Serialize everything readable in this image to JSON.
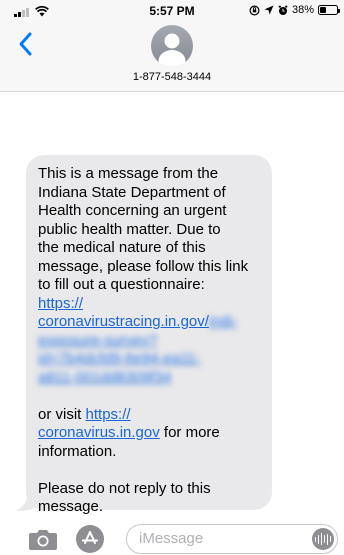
{
  "status_bar": {
    "time": "5:57 PM",
    "battery_text": "38%",
    "battery_level": 0.38,
    "icons": [
      "signal-icon",
      "wifi-icon",
      "orientation-lock-icon",
      "location-icon",
      "alarm-icon",
      "battery-icon"
    ]
  },
  "header": {
    "back_icon": "chevron-left-icon",
    "avatar_icon": "person-icon",
    "contact": "1-877-548-3444"
  },
  "message": {
    "lines_a": [
      "This is a message from the",
      "Indiana State Department of",
      "Health concerning an urgent",
      "public health matter.  Due to",
      "the medical nature of this",
      "message, please follow this link",
      "to fill out a questionnaire:"
    ],
    "link1_line1": "https://",
    "link1_line2": "coronavirustracing.in.gov/",
    "link1_blur_lines": [
      "indi-",
      "exposure-survey?",
      "id=7b4dcfd9-6e94-ea11-",
      "a811-001dd8309f34"
    ],
    "visit_prefix": "or visit ",
    "link2_line1": "https://",
    "link2_line2": "coronavirus.in.gov",
    "visit_suffix": " for more",
    "visit_end": "information.",
    "closing_line1": "Please do not reply to this",
    "closing_line2": "message."
  },
  "input_bar": {
    "camera_icon": "camera-icon",
    "apps_icon": "app-store-icon",
    "placeholder": "iMessage",
    "audio_icon": "audio-waveform-icon"
  },
  "colors": {
    "link": "#1a66d8",
    "bubble": "#e9e9eb",
    "accent": "#007aff"
  }
}
